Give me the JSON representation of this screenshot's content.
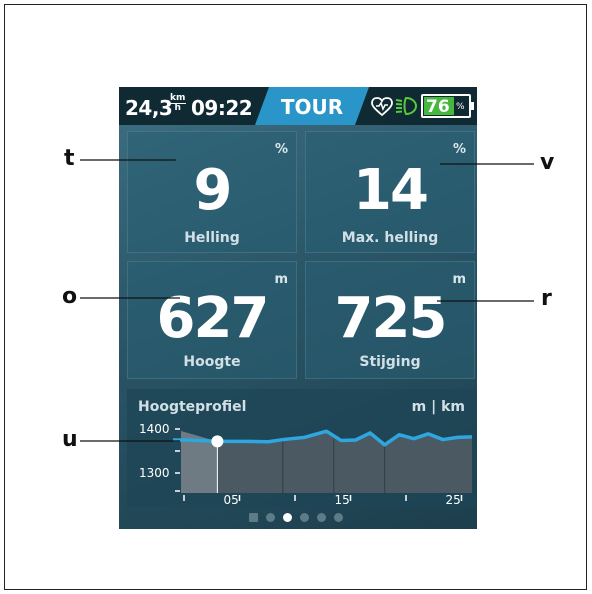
{
  "status_bar": {
    "speed": "24,3",
    "speed_unit_top": "km",
    "speed_unit_bottom": "h",
    "time": "09:22",
    "mode": "TOUR",
    "battery_percent": "76",
    "battery_symbol": "%",
    "heart_icon": "heart-rate-icon",
    "light_icon": "headlight-icon",
    "colors": {
      "mode": "#2a95c8",
      "battery": "#48b83d"
    }
  },
  "tiles": [
    {
      "value": "9",
      "unit": "%",
      "label": "Helling"
    },
    {
      "value": "14",
      "unit": "%",
      "label": "Max. helling"
    },
    {
      "value": "627",
      "unit": "m",
      "label": "Hoogte"
    },
    {
      "value": "725",
      "unit": "m",
      "label": "Stijging"
    }
  ],
  "elevation_profile": {
    "title": "Hoogteprofiel",
    "units": "m | km",
    "y_ticks": [
      "1400",
      "1300"
    ],
    "x_ticks": [
      "05",
      "15",
      "25"
    ],
    "current_km": 5
  },
  "pager": {
    "count": 6,
    "active_index": 2
  },
  "callouts": [
    "t",
    "v",
    "o",
    "r",
    "u"
  ],
  "chart_data": {
    "type": "line",
    "title": "Hoogteprofiel",
    "xlabel": "km",
    "ylabel": "m",
    "x_ticks": [
      "05",
      "15",
      "25"
    ],
    "y_ticks": [
      1400,
      1300
    ],
    "current_position_km": 5,
    "x": [
      0,
      1,
      5,
      9,
      12,
      14,
      17,
      20,
      22,
      24,
      26,
      28,
      30,
      32,
      34,
      36,
      38,
      40
    ],
    "y": [
      1375,
      1375,
      1372,
      1372,
      1371,
      1376,
      1381,
      1395,
      1374,
      1375,
      1391,
      1364,
      1387,
      1378,
      1389,
      1376,
      1381,
      1382
    ],
    "colors": {
      "line": "#2ea6e0",
      "past_fill": "#6e7b82",
      "future_fill": "#4b5a62"
    }
  }
}
